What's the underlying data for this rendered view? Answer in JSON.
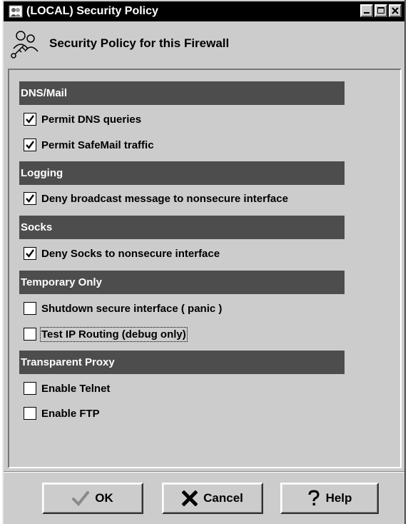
{
  "window": {
    "title": "(LOCAL) Security Policy",
    "header": "Security Policy for this Firewall",
    "icons": {
      "app": "app-icon",
      "header": "people-key-icon"
    }
  },
  "sections": [
    {
      "title": "DNS/Mail"
    },
    {
      "title": "Logging"
    },
    {
      "title": "Socks"
    },
    {
      "title": "Temporary Only"
    },
    {
      "title": "Transparent Proxy"
    }
  ],
  "options": [
    {
      "label": "Permit DNS queries",
      "checked": true
    },
    {
      "label": "Permit SafeMail traffic",
      "checked": true
    },
    {
      "label": "Deny broadcast message to nonsecure interface",
      "checked": true
    },
    {
      "label": "Deny Socks to nonsecure interface",
      "checked": true
    },
    {
      "label": "Shutdown secure interface ( panic )",
      "checked": false
    },
    {
      "label": "Test IP Routing (debug only)",
      "checked": false
    },
    {
      "label": "Enable Telnet",
      "checked": false
    },
    {
      "label": "Enable FTP",
      "checked": false
    }
  ],
  "buttons": {
    "ok": "OK",
    "cancel": "Cancel",
    "help": "Help"
  }
}
